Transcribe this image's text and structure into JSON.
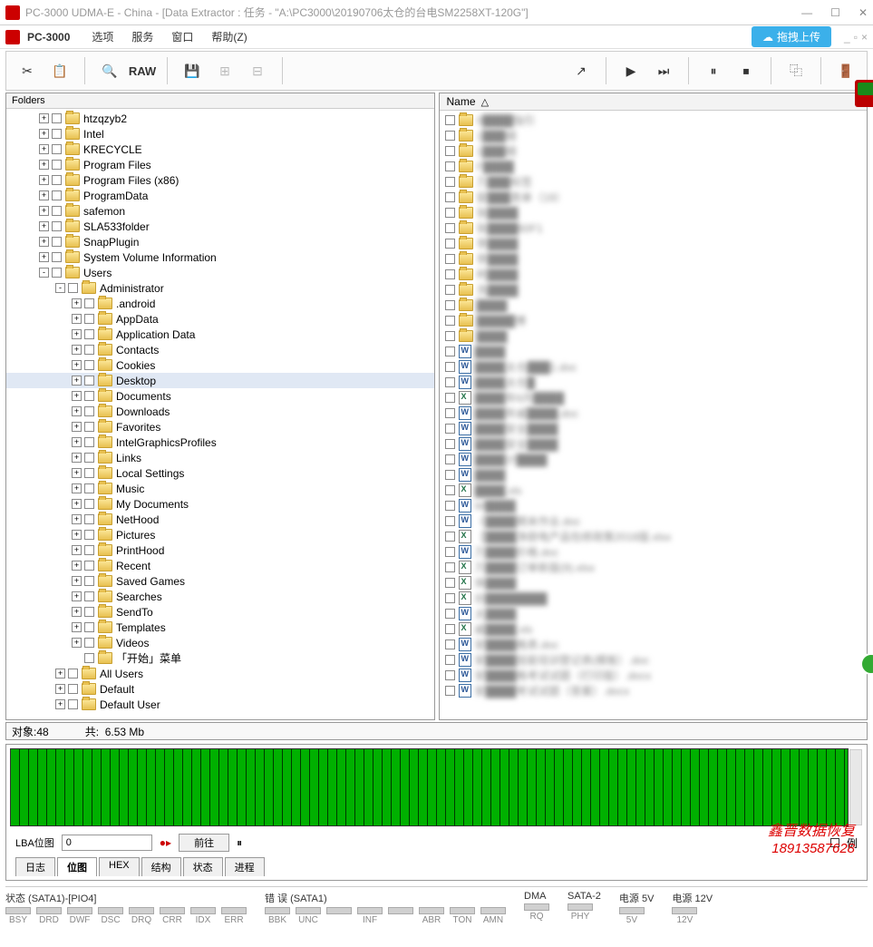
{
  "titlebar": {
    "title": "PC-3000 UDMA-E - China - [Data Extractor : 任务 - \"A:\\PC3000\\20190706太仓的台电SM2258XT-120G\"]"
  },
  "menubar": {
    "brand": "PC-3000",
    "items": [
      "选项",
      "服务",
      "窗口",
      "帮助(Z)"
    ],
    "upload": "拖拽上传"
  },
  "toolbar": {
    "raw": "RAW"
  },
  "folders": {
    "header": "Folders",
    "tree": [
      {
        "d": 2,
        "e": "+",
        "label": "htzqzyb2"
      },
      {
        "d": 2,
        "e": "+",
        "label": "Intel"
      },
      {
        "d": 2,
        "e": "+",
        "label": "KRECYCLE"
      },
      {
        "d": 2,
        "e": "+",
        "label": "Program Files"
      },
      {
        "d": 2,
        "e": "+",
        "label": "Program Files (x86)"
      },
      {
        "d": 2,
        "e": "+",
        "label": "ProgramData"
      },
      {
        "d": 2,
        "e": "+",
        "label": "safemon"
      },
      {
        "d": 2,
        "e": "+",
        "label": "SLA533folder"
      },
      {
        "d": 2,
        "e": "+",
        "label": "SnapPlugin"
      },
      {
        "d": 2,
        "e": "+",
        "label": "System Volume Information"
      },
      {
        "d": 2,
        "e": "-",
        "label": "Users"
      },
      {
        "d": 3,
        "e": "-",
        "label": "Administrator"
      },
      {
        "d": 4,
        "e": "+",
        "label": ".android"
      },
      {
        "d": 4,
        "e": "+",
        "label": "AppData"
      },
      {
        "d": 4,
        "e": "+",
        "label": "Application Data"
      },
      {
        "d": 4,
        "e": "+",
        "label": "Contacts"
      },
      {
        "d": 4,
        "e": "+",
        "label": "Cookies"
      },
      {
        "d": 4,
        "e": "+",
        "label": "Desktop",
        "sel": true
      },
      {
        "d": 4,
        "e": "+",
        "label": "Documents"
      },
      {
        "d": 4,
        "e": "+",
        "label": "Downloads"
      },
      {
        "d": 4,
        "e": "+",
        "label": "Favorites"
      },
      {
        "d": 4,
        "e": "+",
        "label": "IntelGraphicsProfiles"
      },
      {
        "d": 4,
        "e": "+",
        "label": "Links"
      },
      {
        "d": 4,
        "e": "+",
        "label": "Local Settings"
      },
      {
        "d": 4,
        "e": "+",
        "label": "Music"
      },
      {
        "d": 4,
        "e": "+",
        "label": "My Documents"
      },
      {
        "d": 4,
        "e": "+",
        "label": "NetHood"
      },
      {
        "d": 4,
        "e": "+",
        "label": "Pictures"
      },
      {
        "d": 4,
        "e": "+",
        "label": "PrintHood"
      },
      {
        "d": 4,
        "e": "+",
        "label": "Recent"
      },
      {
        "d": 4,
        "e": "+",
        "label": "Saved Games"
      },
      {
        "d": 4,
        "e": "+",
        "label": "Searches"
      },
      {
        "d": 4,
        "e": "+",
        "label": "SendTo"
      },
      {
        "d": 4,
        "e": "+",
        "label": "Templates"
      },
      {
        "d": 4,
        "e": "+",
        "label": "Videos"
      },
      {
        "d": 4,
        "e": " ",
        "label": "「开始」菜单"
      },
      {
        "d": 3,
        "e": "+",
        "label": "All Users"
      },
      {
        "d": 3,
        "e": "+",
        "label": "Default"
      },
      {
        "d": 3,
        "e": "+",
        "label": "Default User"
      }
    ]
  },
  "files": {
    "header": "Name",
    "rows": [
      {
        "t": "folder",
        "label": "0████指引",
        "blur": true
      },
      {
        "t": "folder",
        "label": "1███细",
        "blur": true
      },
      {
        "t": "folder",
        "label": "1███细",
        "blur": true
      },
      {
        "t": "folder",
        "label": "F████",
        "blur": true
      },
      {
        "t": "folder",
        "label": "万███标签",
        "blur": true
      },
      {
        "t": "folder",
        "label": "窗███类单（19）",
        "blur": true
      },
      {
        "t": "folder",
        "label": "张████",
        "blur": true
      },
      {
        "t": "folder",
        "label": "张████60F1",
        "blur": true
      },
      {
        "t": "folder",
        "label": "李████",
        "blur": true
      },
      {
        "t": "folder",
        "label": "李████",
        "blur": true
      },
      {
        "t": "folder",
        "label": "柯████",
        "blur": true
      },
      {
        "t": "folder",
        "label": "洗████",
        "blur": true
      },
      {
        "t": "folder",
        "label": "████",
        "blur": true
      },
      {
        "t": "folder",
        "label": "█████博",
        "blur": true
      },
      {
        "t": "folder",
        "label": "████",
        "blur": true
      },
      {
        "t": "word",
        "label": "████",
        "blur": true
      },
      {
        "t": "word",
        "label": "████太仓███1.doc",
        "blur": true
      },
      {
        "t": "word",
        "label": "████太仓█",
        "blur": true
      },
      {
        "t": "excel",
        "label": "████年6月████",
        "blur": true
      },
      {
        "t": "word",
        "label": "████年威████.doc",
        "blur": true
      },
      {
        "t": "word",
        "label": "████安全████",
        "blur": true
      },
      {
        "t": "word",
        "label": "████安全████",
        "blur": true
      },
      {
        "t": "word",
        "label": "████计████",
        "blur": true
      },
      {
        "t": "word",
        "label": "████",
        "blur": true
      },
      {
        "t": "excel",
        "label": "████.xls",
        "blur": true
      },
      {
        "t": "word",
        "label": "W████",
        "blur": true
      },
      {
        "t": "word",
        "label": "《████期末作业.doc",
        "blur": true
      },
      {
        "t": "excel",
        "label": "【████净厨电产品包修政策2018版.xlsx",
        "blur": true
      },
      {
        "t": "word",
        "label": "万████价格.doc",
        "blur": true
      },
      {
        "t": "excel",
        "label": "万████订单新版(9).xlsx",
        "blur": true
      },
      {
        "t": "excel",
        "label": "体████",
        "blur": true
      },
      {
        "t": "excel",
        "label": "创████████",
        "blur": true
      },
      {
        "t": "word",
        "label": "太████",
        "blur": true
      },
      {
        "t": "excel",
        "label": "威████.xls",
        "blur": true
      },
      {
        "t": "word",
        "label": "安████格表.doc",
        "blur": true
      },
      {
        "t": "word",
        "label": "安████技能培训登记表(模板）.doc",
        "blur": true
      },
      {
        "t": "word",
        "label": "安████格考试试题（打印版）.docx",
        "blur": true
      },
      {
        "t": "word",
        "label": "安████考试试题（答案）.docx",
        "blur": true
      }
    ]
  },
  "status": {
    "objects_label": "对象:",
    "objects_value": "48",
    "total_label": "共:",
    "total_value": "6.53 Mb"
  },
  "lba": {
    "label": "LBA位图",
    "value": "0",
    "goto": "前往",
    "legend": "例"
  },
  "tabs": [
    "日志",
    "位图",
    "HEX",
    "结构",
    "状态",
    "进程"
  ],
  "bottom": {
    "groups": [
      {
        "label": "状态 (SATA1)-[PIO4]",
        "leds": [
          "BSY",
          "DRD",
          "DWF",
          "DSC",
          "DRQ",
          "CRR",
          "IDX",
          "ERR"
        ]
      },
      {
        "label": "错 误 (SATA1)",
        "leds": [
          "BBK",
          "UNC",
          "",
          "INF",
          "",
          "ABR",
          "TON",
          "AMN"
        ]
      },
      {
        "label": "DMA",
        "leds": [
          "RQ"
        ]
      },
      {
        "label": "SATA-2",
        "leds": [
          "PHY"
        ]
      },
      {
        "label": "电源 5V",
        "leds": [
          "5V"
        ]
      },
      {
        "label": "电源 12V",
        "leds": [
          "12V"
        ]
      }
    ]
  },
  "watermark": {
    "line1": "鑫晋数据恢复",
    "line2": "18913587628"
  }
}
